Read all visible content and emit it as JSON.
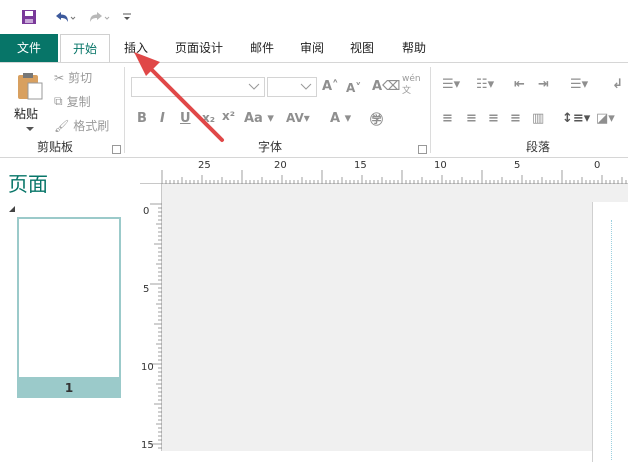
{
  "qat": {
    "save": "save-icon",
    "undo": "undo-icon",
    "redo": "redo-icon",
    "customize": "customize-icon"
  },
  "tabs": [
    {
      "label": "文件"
    },
    {
      "label": "开始"
    },
    {
      "label": "插入"
    },
    {
      "label": "页面设计"
    },
    {
      "label": "邮件"
    },
    {
      "label": "审阅"
    },
    {
      "label": "视图"
    },
    {
      "label": "帮助"
    }
  ],
  "clipboard": {
    "paste": "粘贴",
    "cut": "剪切",
    "copy": "复制",
    "format_painter": "格式刷",
    "group": "剪贴板"
  },
  "font": {
    "group": "字体",
    "phonetic": "wén\n文"
  },
  "paragraph": {
    "group": "段落"
  },
  "pages_pane": {
    "title": "页面",
    "page_number": "1"
  },
  "hruler": [
    {
      "label": "25"
    },
    {
      "label": "20"
    },
    {
      "label": "15"
    },
    {
      "label": "10"
    },
    {
      "label": "5"
    },
    {
      "label": "0"
    }
  ],
  "vruler": [
    {
      "label": "0"
    },
    {
      "label": "5"
    },
    {
      "label": "10"
    },
    {
      "label": "15"
    }
  ],
  "colors": {
    "accent": "#077568",
    "thumb_border": "#9bcaca",
    "arrow": "#e04848"
  }
}
